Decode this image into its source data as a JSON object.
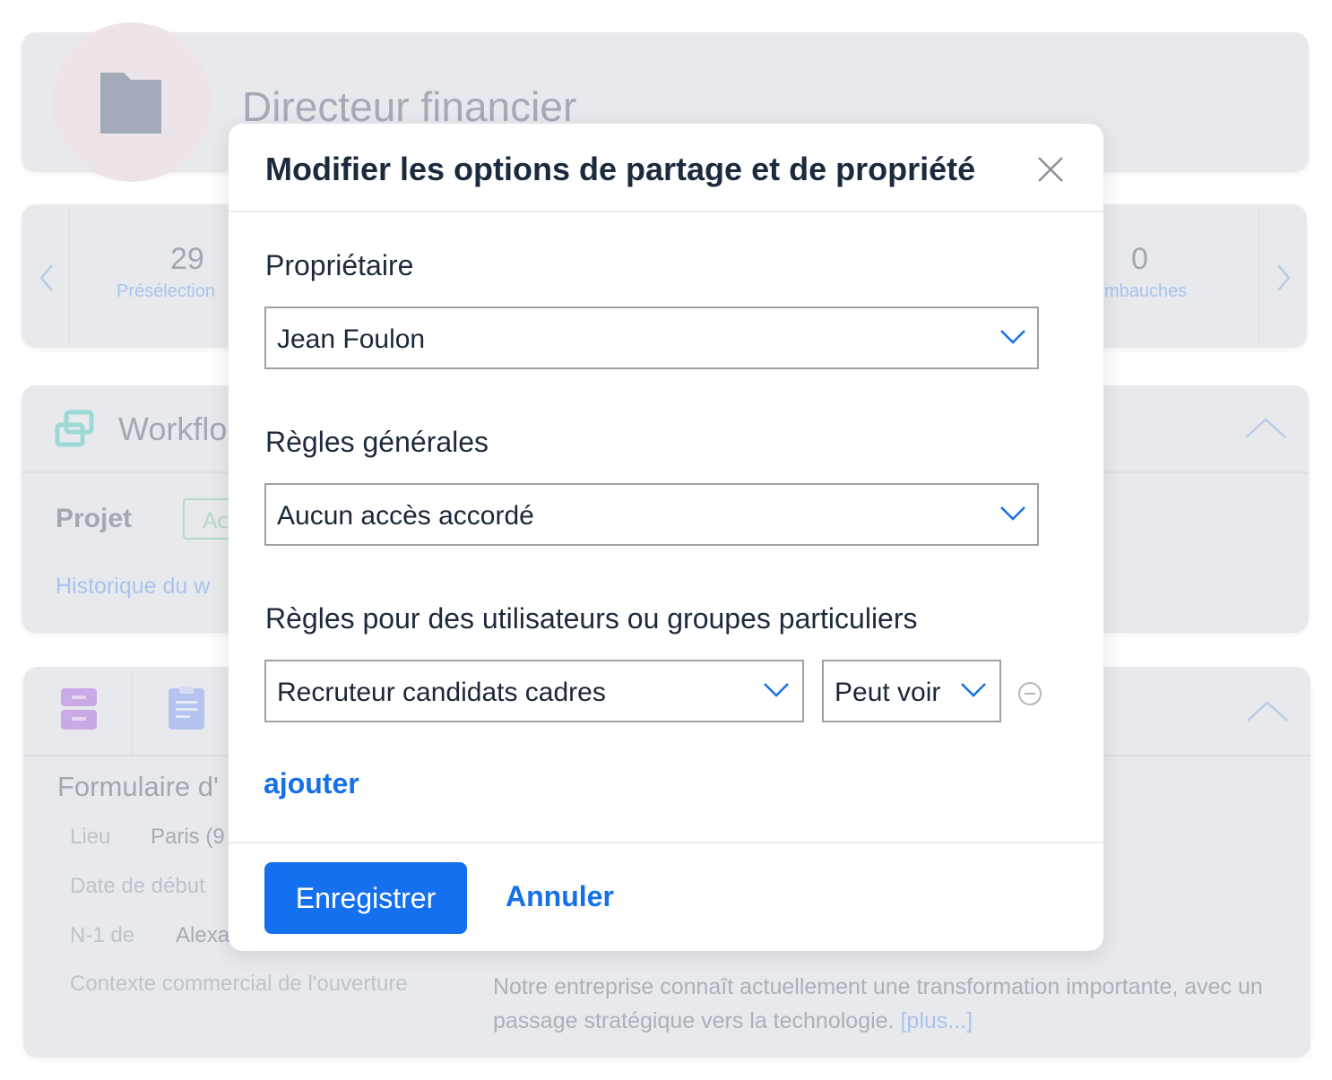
{
  "background": {
    "job_title": "Directeur financier",
    "stats": [
      {
        "value": "29",
        "label": "Présélection"
      },
      {
        "value": "0",
        "label": "mbauches"
      }
    ],
    "workflow": {
      "title": "Workflo",
      "project_label": "Projet",
      "project_tag": "Ac",
      "history_link": "Historique du w"
    },
    "form": {
      "title": "Formulaire d'",
      "fields": [
        {
          "label": "Lieu",
          "value": "Paris (9"
        },
        {
          "label": "Date de début",
          "value": ""
        },
        {
          "label": "N-1 de",
          "value": "Alexa"
        },
        {
          "label": "Contexte commercial de l'ouverture",
          "value": "Notre entreprise connaît actuellement une transformation importante, avec un passage stratégique vers la technologie."
        }
      ],
      "more_link": "[plus...]"
    }
  },
  "modal": {
    "title": "Modifier les options de partage et de propriété",
    "owner_label": "Propriétaire",
    "owner_value": "Jean Foulon",
    "general_rules_label": "Règles générales",
    "general_rules_value": "Aucun accès accordé",
    "specific_rules_label": "Règles pour des utilisateurs ou groupes particuliers",
    "rule_group_value": "Recruteur candidats cadres",
    "rule_permission_value": "Peut voir",
    "add_label": "ajouter",
    "save_label": "Enregistrer",
    "cancel_label": "Annuler"
  },
  "colors": {
    "primary": "#1570ef",
    "title_text": "#1b2a3d",
    "background_card": "#e8e9ed"
  }
}
